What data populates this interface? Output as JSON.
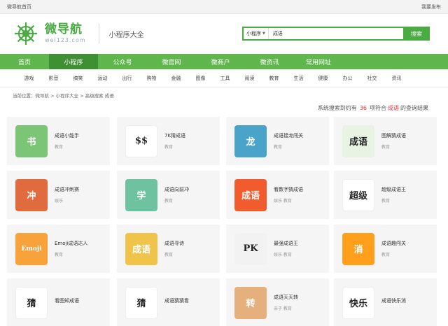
{
  "topbar": {
    "left": "微导航首页",
    "right": "我要发布"
  },
  "header": {
    "logo_title": "微导航",
    "logo_sub": "wei123.com",
    "slogan": "小程序大全"
  },
  "search": {
    "select_value": "小程序",
    "query": "成语",
    "button": "搜索"
  },
  "nav": [
    "首页",
    "小程序",
    "公众号",
    "微官网",
    "微商户",
    "微资讯",
    "常用网址"
  ],
  "nav_active_index": 1,
  "subnav": [
    "游戏",
    "影音",
    "搞笑",
    "运动",
    "出行",
    "购物",
    "金融",
    "图像",
    "工具",
    "阅读",
    "教育",
    "生活",
    "健康",
    "办公",
    "社交",
    "资讯"
  ],
  "breadcrumb": "当前位置：微导航 > 小程序大全 > 高级搜索 成语",
  "result": {
    "prefix": "系统搜索到约有",
    "count": "36",
    "mid": "项符合",
    "keyword": "成语",
    "suffix": "的查询结果"
  },
  "apps": [
    {
      "name": "成语小能手",
      "cat": "教育",
      "icon": "boy-reading-icon",
      "bg": "#7cc576",
      "glyph": "书"
    },
    {
      "name": "7K猜成语",
      "cat": "教育",
      "icon": "money-owl-icon",
      "bg": "#ffffff",
      "glyph": "$$"
    },
    {
      "name": "成语接龙闯关",
      "cat": "教育",
      "icon": "hero-icon",
      "bg": "#4aa3c8",
      "glyph": "龙"
    },
    {
      "name": "图解猜成语",
      "cat": "教育",
      "icon": "calligraphy-icon",
      "bg": "#e8f3e4",
      "glyph": "成语"
    },
    {
      "name": "成语冲刺赛",
      "cat": "娱乐",
      "icon": "warrior-icon",
      "bg": "#e06b3e",
      "glyph": "冲"
    },
    {
      "name": "成语向前冲",
      "cat": "教育",
      "icon": "grad-cap-icon",
      "bg": "#6fc2a0",
      "glyph": "学"
    },
    {
      "name": "看数字猜成语",
      "cat": "娱乐 教育",
      "icon": "girl-icon",
      "bg": "#f25b2e",
      "glyph": "成语"
    },
    {
      "name": "超级成语王",
      "cat": "教育",
      "icon": "super-king-icon",
      "bg": "#ffffff",
      "glyph": "超级"
    },
    {
      "name": "Emoji成语达人",
      "cat": "教育",
      "icon": "emoji-icon",
      "bg": "#f7a23a",
      "glyph": "Emoji"
    },
    {
      "name": "成语寻诗",
      "cat": "教育",
      "icon": "lantern-icon",
      "bg": "#f0c44a",
      "glyph": "成语"
    },
    {
      "name": "最强成语王",
      "cat": "娱乐 教育",
      "icon": "lady-icon",
      "bg": "#f2f2f2",
      "glyph": "PK"
    },
    {
      "name": "成语趣闯关",
      "cat": "教育",
      "icon": "flag-icon",
      "bg": "#ff9f1c",
      "glyph": "消"
    },
    {
      "name": "看图知成语",
      "cat": "",
      "icon": "ink-icon",
      "bg": "#ffffff",
      "glyph": "猜"
    },
    {
      "name": "成语猜猜看",
      "cat": "",
      "icon": "pig-icon",
      "bg": "#ffffff",
      "glyph": "猜"
    },
    {
      "name": "成语天天转",
      "cat": "亲子 教育",
      "icon": "seal-icon",
      "bg": "#e5b07b",
      "glyph": "转"
    },
    {
      "name": "成语快乐消",
      "cat": "",
      "icon": "circle-text-icon",
      "bg": "#ffffff",
      "glyph": "快乐"
    }
  ]
}
